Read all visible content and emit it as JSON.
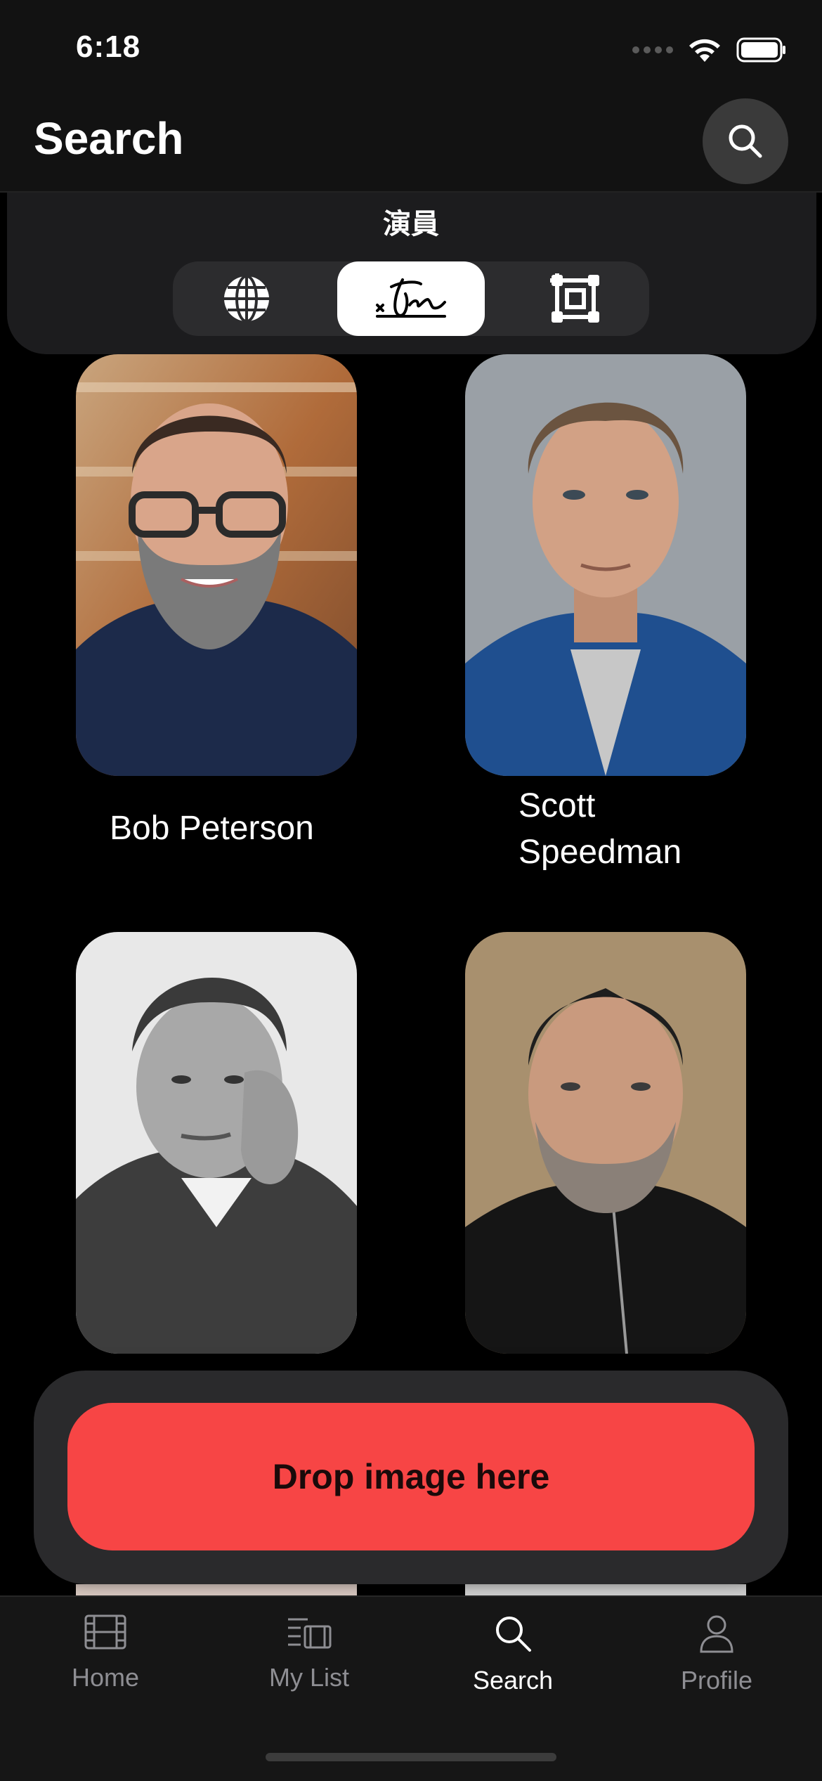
{
  "status_bar": {
    "time": "6:18"
  },
  "header": {
    "title": "Search",
    "search_icon": "magnifier-icon"
  },
  "filter": {
    "title": "演員",
    "segments": [
      {
        "icon": "globe-icon",
        "active": false
      },
      {
        "icon": "signature-icon",
        "active": true
      },
      {
        "icon": "crop-frame-icon",
        "active": false
      }
    ]
  },
  "results": [
    {
      "name": "Bob Peterson"
    },
    {
      "name": "Scott Speedman"
    },
    {
      "name": ""
    },
    {
      "name": ""
    }
  ],
  "drop_zone": {
    "label": "Drop image here",
    "color": "#f74545"
  },
  "tab_bar": {
    "items": [
      {
        "label": "Home",
        "icon": "film-icon"
      },
      {
        "label": "My List",
        "icon": "list-icon"
      },
      {
        "label": "Search",
        "icon": "search-icon",
        "active": true
      },
      {
        "label": "Profile",
        "icon": "person-icon"
      }
    ]
  }
}
